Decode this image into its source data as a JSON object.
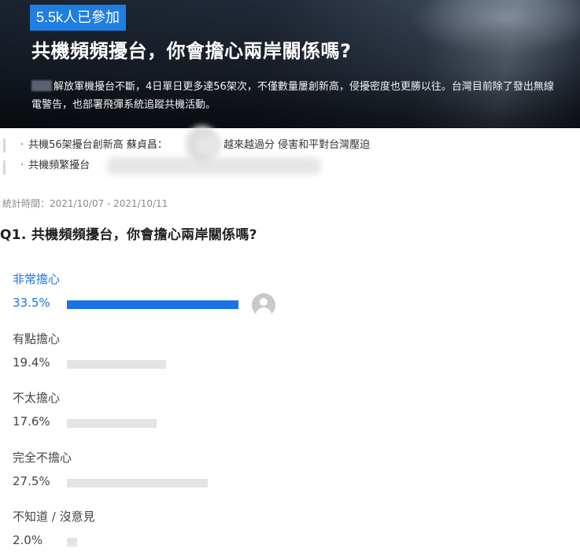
{
  "banner": {
    "participants": "5.5k人已參加",
    "title": "共機頻頻擾台，你會擔心兩岸關係嗎?",
    "description": "解放軍機擾台不斷，4日單日更多達56架次，不僅數量屢創新高，侵擾密度也更勝以往。台灣目前除了發出無線電警告，也部署飛彈系統追蹤共機活動。"
  },
  "related": [
    {
      "text": "共機56架擾台創新高 蘇貞昌："
    },
    {
      "text": "越來越過分 侵害和平對台灣壓迫"
    },
    {
      "text": "共機頻繁擾台"
    }
  ],
  "stats": {
    "period": "統計時間：2021/10/07 - 2021/10/11",
    "question": "Q1. 共機頻頻擾台，你會擔心兩岸關係嗎?",
    "options": [
      {
        "label": "非常擔心",
        "percent": "33.5%",
        "value": 33.5,
        "selected": true
      },
      {
        "label": "有點擔心",
        "percent": "19.4%",
        "value": 19.4,
        "selected": false
      },
      {
        "label": "不太擔心",
        "percent": "17.6%",
        "value": 17.6,
        "selected": false
      },
      {
        "label": "完全不擔心",
        "percent": "27.5%",
        "value": 27.5,
        "selected": false
      },
      {
        "label": "不知道 / 沒意見",
        "percent": "2.0%",
        "value": 2.0,
        "selected": false
      }
    ]
  },
  "colors": {
    "accent": "#1a73e8",
    "badge": "#1e7fe0",
    "bar_unselected": "#e3e4e6"
  },
  "icons": {
    "voter": "user-avatar-icon"
  }
}
